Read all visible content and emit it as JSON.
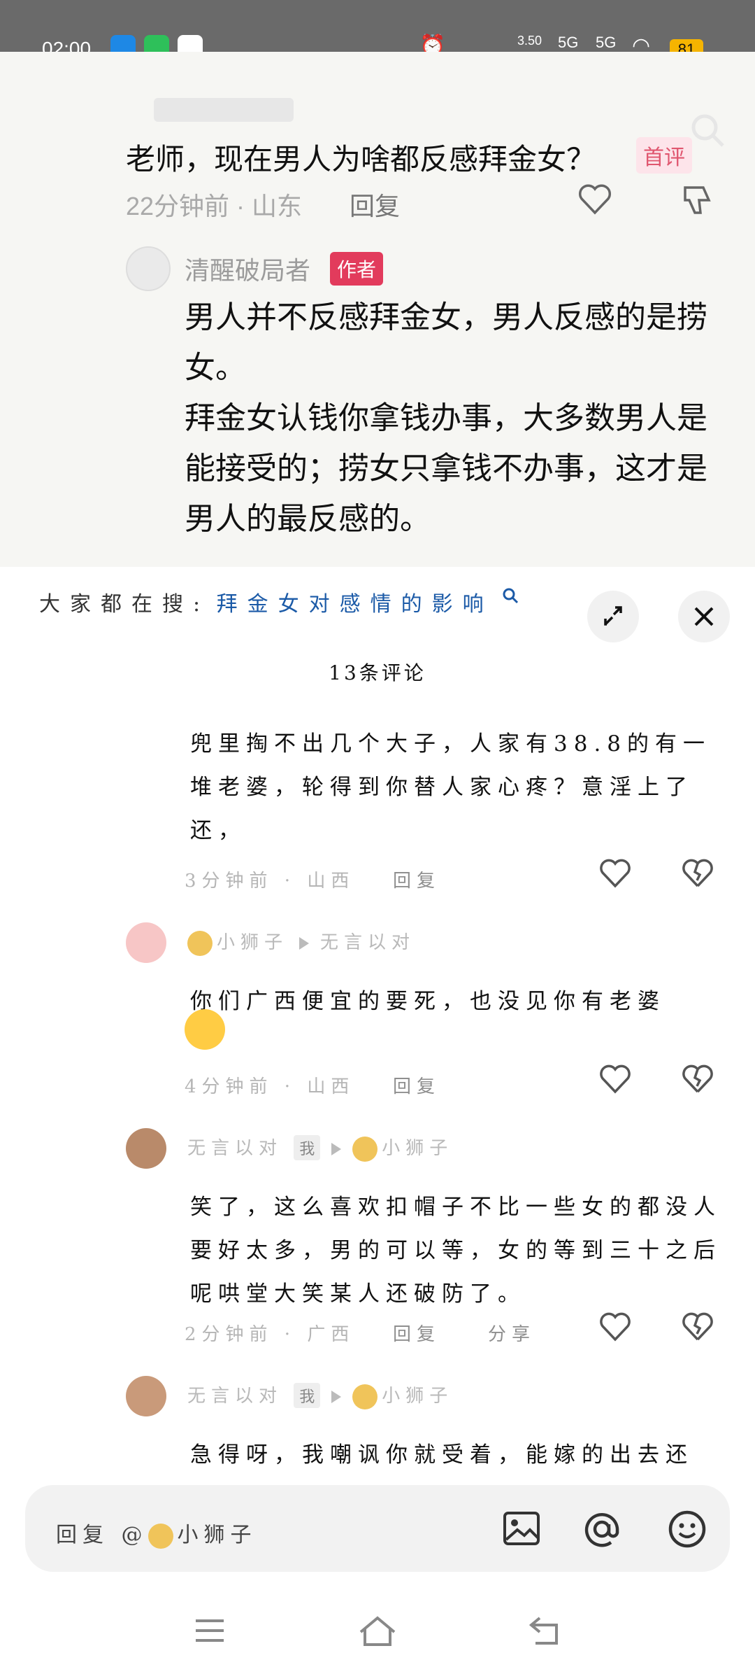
{
  "status_bar": {
    "time": "02:00",
    "speed": "3.50",
    "net1": "5G",
    "net2": "5G",
    "battery": "81"
  },
  "thread": {
    "question": "老师，现在男人为啥都反感拜金女？",
    "first_tag": "首评",
    "meta": "22分钟前 · 山东",
    "reply": "回复",
    "author_name": "清醒破局者",
    "author_badge": "作者",
    "author_reply": "男人并不反感拜金女，男人反感的是捞女。\n拜金女认钱你拿钱办事，大多数男人是能接受的；捞女只拿钱不办事，这才是男人的最反感的。"
  },
  "sheet": {
    "suggest_label": "大家都在搜:",
    "suggest_link": "拜金女对感情的影响",
    "count_title": "13条评论",
    "comments": [
      {
        "text": "兜里掏不出几个大子，人家有38.8的有一堆老婆，轮得到你替人家心疼？意淫上了还，",
        "meta": "3分钟前 · 山西",
        "reply": "回复"
      },
      {
        "user": "小狮子",
        "target": "无言以对",
        "text": "你们广西便宜的要死，也没见你有老婆",
        "meta": "4分钟前 · 山西",
        "reply": "回复"
      },
      {
        "user": "无言以对",
        "me_tag": "我",
        "target": "小狮子",
        "text": "笑了，这么喜欢扣帽子不比一些女的都没人要好太多，男的可以等，女的等到三十之后呢哄堂大笑某人还破防了。",
        "meta": "2分钟前 · 广西",
        "reply": "回复",
        "share": "分享"
      },
      {
        "user": "无言以对",
        "me_tag": "我",
        "target": "小狮子",
        "text": "急得呀，我嘲讽你就受着，能嫁的出去还"
      }
    ],
    "input_placeholder": "回复 @",
    "input_target": "小狮子"
  },
  "colors": {
    "accent_link": "#1b5aa7",
    "badge_red": "#e23b5c",
    "battery": "#f5b400"
  }
}
